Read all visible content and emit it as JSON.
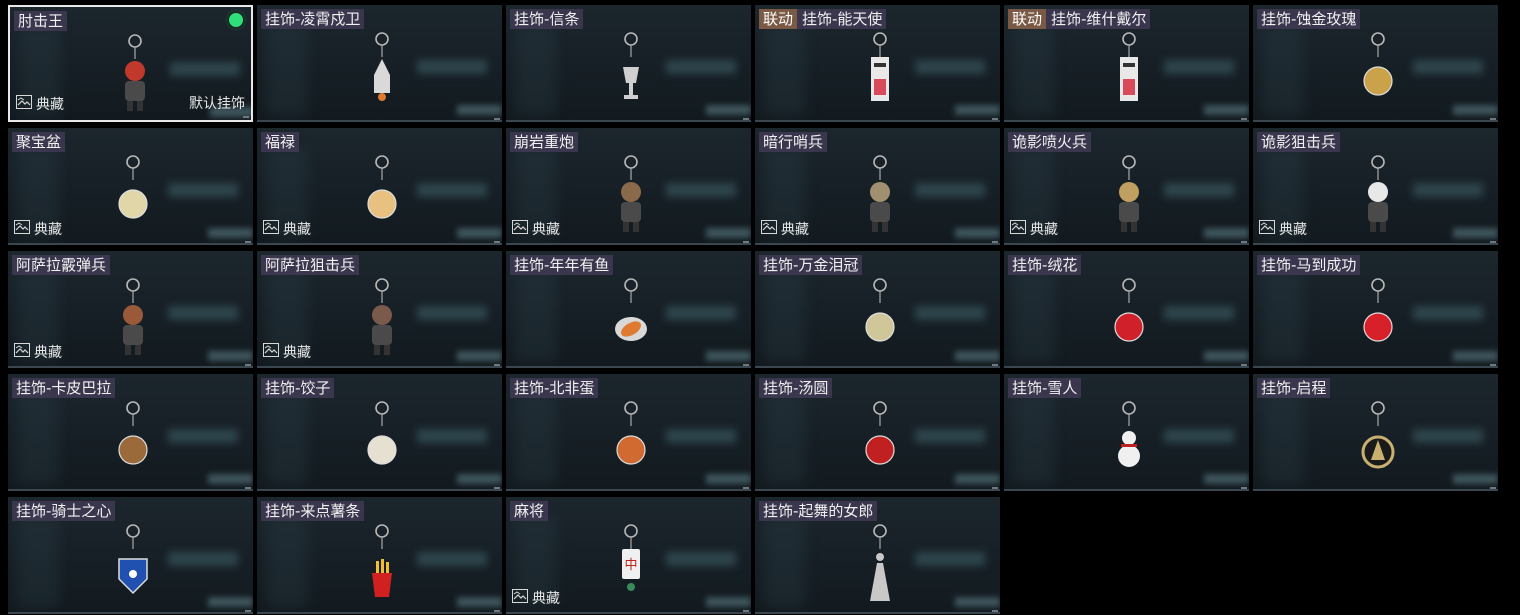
{
  "items": [
    {
      "name": "肘击王",
      "collab": "",
      "favorite": true,
      "favorite_label": "典藏",
      "default_label": "默认挂饰",
      "selected": true,
      "equipped": true,
      "icon": "mascot-charm",
      "color": "#c0392b"
    },
    {
      "name": "挂饰-凌霄戍卫",
      "collab": "",
      "favorite": false,
      "favorite_label": "",
      "default_label": "",
      "selected": false,
      "equipped": false,
      "icon": "rocket-charm",
      "color": "#d9d9d9"
    },
    {
      "name": "挂饰-信条",
      "collab": "",
      "favorite": false,
      "favorite_label": "",
      "default_label": "",
      "selected": false,
      "equipped": false,
      "icon": "trophy-charm",
      "color": "#cfcfcf"
    },
    {
      "name": "挂饰-能天使",
      "collab": "联动",
      "favorite": false,
      "favorite_label": "",
      "default_label": "",
      "selected": false,
      "equipped": false,
      "icon": "tag-charm",
      "color": "#d94b5a"
    },
    {
      "name": "挂饰-维什戴尔",
      "collab": "联动",
      "favorite": false,
      "favorite_label": "",
      "default_label": "",
      "selected": false,
      "equipped": false,
      "icon": "tag-charm",
      "color": "#d94b5a"
    },
    {
      "name": "挂饰-蚀金玫瑰",
      "collab": "",
      "favorite": false,
      "favorite_label": "",
      "default_label": "",
      "selected": false,
      "equipped": false,
      "icon": "gold-rose-charm",
      "color": "#c9a24a"
    },
    {
      "name": "聚宝盆",
      "collab": "",
      "favorite": true,
      "favorite_label": "典藏",
      "default_label": "",
      "selected": false,
      "equipped": false,
      "icon": "treasure-bowl-charm",
      "color": "#e0d6a8"
    },
    {
      "name": "福禄",
      "collab": "",
      "favorite": true,
      "favorite_label": "典藏",
      "default_label": "",
      "selected": false,
      "equipped": false,
      "icon": "gourd-charm",
      "color": "#e8c080"
    },
    {
      "name": "崩岩重炮",
      "collab": "",
      "favorite": true,
      "favorite_label": "典藏",
      "default_label": "",
      "selected": false,
      "equipped": false,
      "icon": "soldier-charm",
      "color": "#8a6a4a"
    },
    {
      "name": "暗行哨兵",
      "collab": "",
      "favorite": true,
      "favorite_label": "典藏",
      "default_label": "",
      "selected": false,
      "equipped": false,
      "icon": "soldier-charm",
      "color": "#a09070"
    },
    {
      "name": "诡影喷火兵",
      "collab": "",
      "favorite": true,
      "favorite_label": "典藏",
      "default_label": "",
      "selected": false,
      "equipped": false,
      "icon": "soldier-charm",
      "color": "#c0a060"
    },
    {
      "name": "诡影狙击兵",
      "collab": "",
      "favorite": true,
      "favorite_label": "典藏",
      "default_label": "",
      "selected": false,
      "equipped": false,
      "icon": "soldier-charm",
      "color": "#e8e8e8"
    },
    {
      "name": "阿萨拉霰弹兵",
      "collab": "",
      "favorite": true,
      "favorite_label": "典藏",
      "default_label": "",
      "selected": false,
      "equipped": false,
      "icon": "warrior-charm",
      "color": "#9a5a3a"
    },
    {
      "name": "阿萨拉狙击兵",
      "collab": "",
      "favorite": true,
      "favorite_label": "典藏",
      "default_label": "",
      "selected": false,
      "equipped": false,
      "icon": "warrior-charm",
      "color": "#7a5a4a"
    },
    {
      "name": "挂饰-年年有鱼",
      "collab": "",
      "favorite": false,
      "favorite_label": "",
      "default_label": "",
      "selected": false,
      "equipped": false,
      "icon": "fish-charm",
      "color": "#e07a30"
    },
    {
      "name": "挂饰-万金泪冠",
      "collab": "",
      "favorite": false,
      "favorite_label": "",
      "default_label": "",
      "selected": false,
      "equipped": false,
      "icon": "crown-charm",
      "color": "#cfc79a"
    },
    {
      "name": "挂饰-绒花",
      "collab": "",
      "favorite": false,
      "favorite_label": "",
      "default_label": "",
      "selected": false,
      "equipped": false,
      "icon": "flower-charm",
      "color": "#d0202a"
    },
    {
      "name": "挂饰-马到成功",
      "collab": "",
      "favorite": false,
      "favorite_label": "",
      "default_label": "",
      "selected": false,
      "equipped": false,
      "icon": "horse-charm",
      "color": "#d8202a"
    },
    {
      "name": "挂饰-卡皮巴拉",
      "collab": "",
      "favorite": false,
      "favorite_label": "",
      "default_label": "",
      "selected": false,
      "equipped": false,
      "icon": "capybara-charm",
      "color": "#9a6a3a"
    },
    {
      "name": "挂饰-饺子",
      "collab": "",
      "favorite": false,
      "favorite_label": "",
      "default_label": "",
      "selected": false,
      "equipped": false,
      "icon": "dumpling-charm",
      "color": "#e6e0d0"
    },
    {
      "name": "挂饰-北非蛋",
      "collab": "",
      "favorite": false,
      "favorite_label": "",
      "default_label": "",
      "selected": false,
      "equipped": false,
      "icon": "shakshuka-charm",
      "color": "#d06a30"
    },
    {
      "name": "挂饰-汤圆",
      "collab": "",
      "favorite": false,
      "favorite_label": "",
      "default_label": "",
      "selected": false,
      "equipped": false,
      "icon": "tangyuan-charm",
      "color": "#c02020"
    },
    {
      "name": "挂饰-雪人",
      "collab": "",
      "favorite": false,
      "favorite_label": "",
      "default_label": "",
      "selected": false,
      "equipped": false,
      "icon": "snowman-charm",
      "color": "#f0f0f0"
    },
    {
      "name": "挂饰-启程",
      "collab": "",
      "favorite": false,
      "favorite_label": "",
      "default_label": "",
      "selected": false,
      "equipped": false,
      "icon": "compass-charm",
      "color": "#c9b070"
    },
    {
      "name": "挂饰-骑士之心",
      "collab": "",
      "favorite": false,
      "favorite_label": "",
      "default_label": "",
      "selected": false,
      "equipped": false,
      "icon": "knight-shield-charm",
      "color": "#2050b0"
    },
    {
      "name": "挂饰-来点薯条",
      "collab": "",
      "favorite": false,
      "favorite_label": "",
      "default_label": "",
      "selected": false,
      "equipped": false,
      "icon": "fries-charm",
      "color": "#d02020"
    },
    {
      "name": "麻将",
      "collab": "",
      "favorite": true,
      "favorite_label": "典藏",
      "default_label": "",
      "selected": false,
      "equipped": false,
      "icon": "mahjong-charm",
      "color": "#f0f0f0"
    },
    {
      "name": "挂饰-起舞的女郎",
      "collab": "",
      "favorite": false,
      "favorite_label": "",
      "default_label": "",
      "selected": false,
      "equipped": false,
      "icon": "dancer-charm",
      "color": "#c8c8c8"
    }
  ]
}
